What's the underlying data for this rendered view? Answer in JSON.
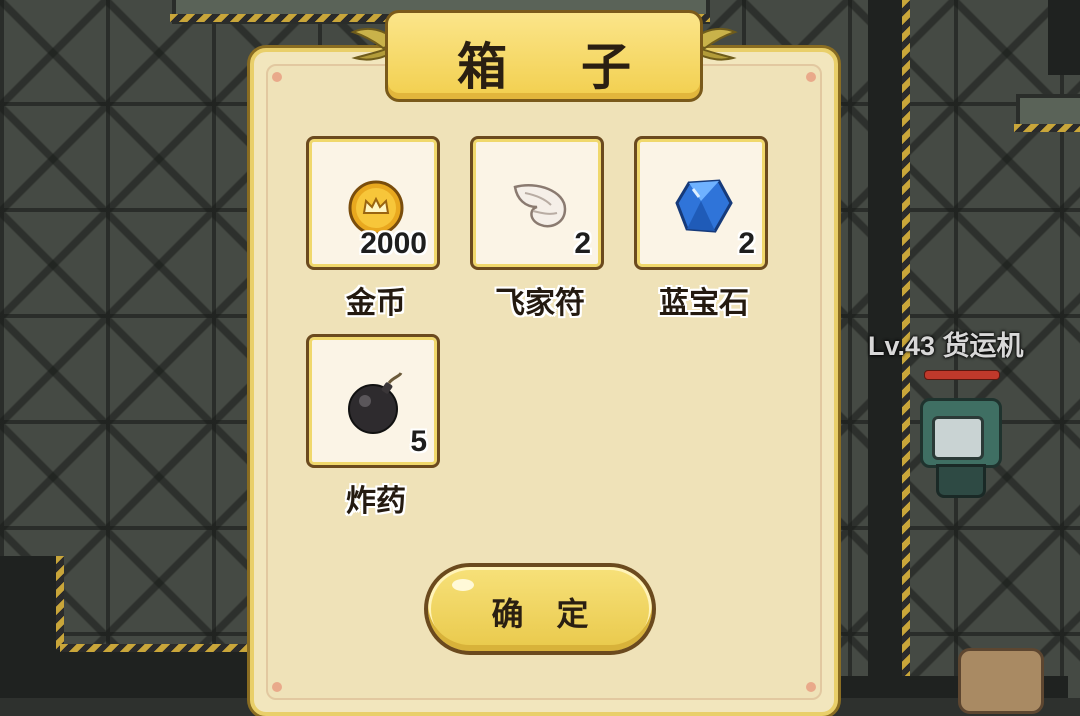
{
  "dialog": {
    "title": "箱 子",
    "confirm_label": "确 定"
  },
  "items": [
    {
      "name": "金币",
      "count": "2000",
      "icon": "gold-coin-icon"
    },
    {
      "name": "飞家符",
      "count": "2",
      "icon": "wing-icon"
    },
    {
      "name": "蓝宝石",
      "count": "2",
      "icon": "blue-gem-icon"
    },
    {
      "name": "炸药",
      "count": "5",
      "icon": "bomb-icon"
    }
  ],
  "enemy": {
    "label": "Lv.43 货运机"
  },
  "colors": {
    "panel": "#f2e6bd",
    "title_plate": "#f2cf4e",
    "slot_border": "#6b4a1e",
    "enemy_hp": "#c0392b"
  }
}
